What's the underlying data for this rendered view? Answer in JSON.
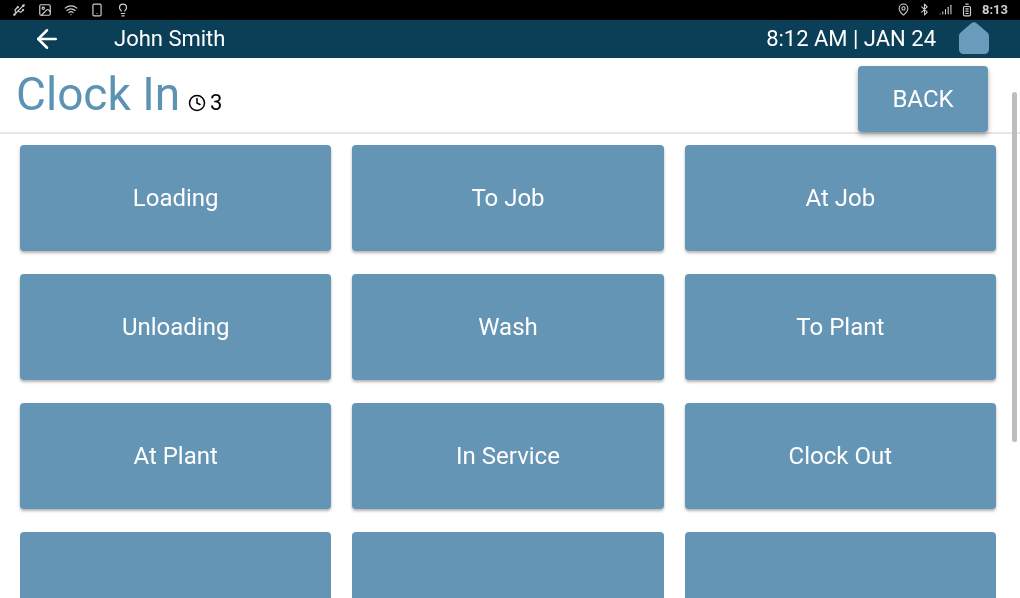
{
  "status_bar": {
    "time": "8:13"
  },
  "header": {
    "user": "John Smith",
    "datetime": "8:12 AM | JAN 24"
  },
  "page": {
    "title": "Clock In",
    "timer_count": "3",
    "back_button": "BACK"
  },
  "tiles": [
    {
      "label": "Loading"
    },
    {
      "label": "To Job"
    },
    {
      "label": "At Job"
    },
    {
      "label": "Unloading"
    },
    {
      "label": "Wash"
    },
    {
      "label": "To Plant"
    },
    {
      "label": "At Plant"
    },
    {
      "label": "In Service"
    },
    {
      "label": "Clock Out"
    }
  ],
  "cut_off_tiles": [
    {
      "kind": "tile"
    },
    {
      "kind": "tile"
    },
    {
      "kind": "tile"
    }
  ]
}
